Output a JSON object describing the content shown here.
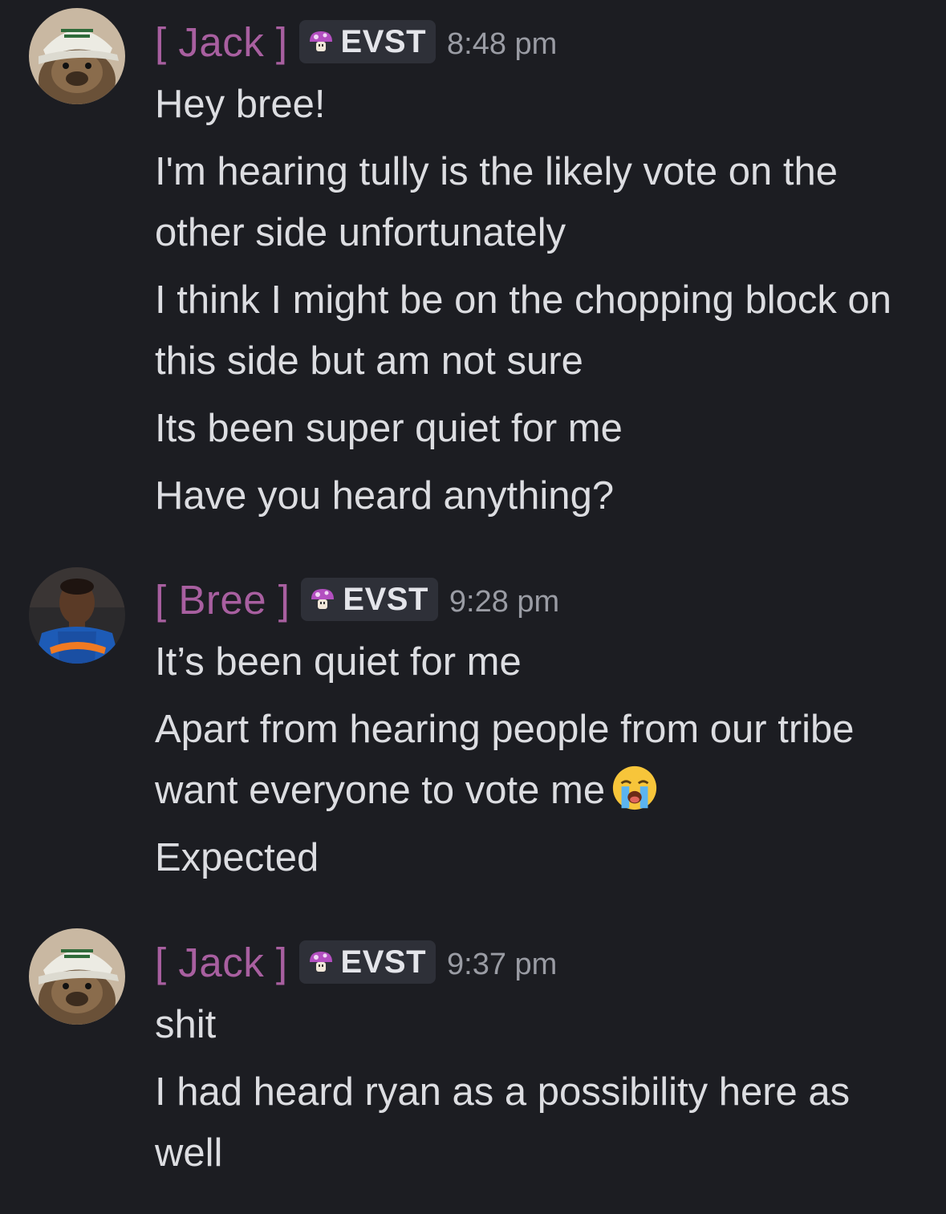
{
  "messages": [
    {
      "author": "[ Jack ]",
      "tag": "EVST",
      "time": "8:48 pm",
      "avatar_icon": "otter-with-cap-avatar",
      "lines": [
        "Hey bree!",
        "I'm hearing tully is the likely vote on the other side unfortunately",
        "I think I might be on the chopping block on this side but am not sure",
        "Its been super quiet for me",
        "Have you heard anything?"
      ]
    },
    {
      "author": "[ Bree ]",
      "tag": "EVST",
      "time": "9:28 pm",
      "avatar_icon": "basketball-player-avatar",
      "lines": [
        "It’s been quiet for me",
        "Apart from hearing people from our tribe want everyone to vote me",
        "Expected"
      ],
      "emoji": "loudly-crying-face-emoji"
    },
    {
      "author": "[ Jack ]",
      "tag": "EVST",
      "time": "9:37 pm",
      "avatar_icon": "otter-with-cap-avatar",
      "lines": [
        "shit",
        "I had heard ryan as a possibility here as well"
      ]
    }
  ],
  "colors": {
    "background": "#1c1d22",
    "username": "#a85fa0",
    "text": "#dcdde1",
    "timestamp": "#9a9ca4",
    "tag_bg": "#2e3038"
  }
}
